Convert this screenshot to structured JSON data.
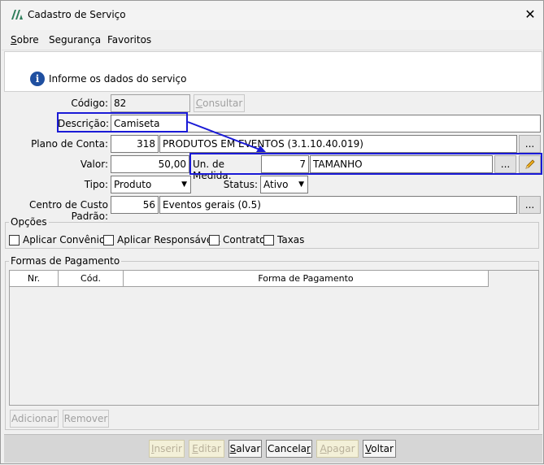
{
  "window": {
    "title": "Cadastro de Serviço",
    "close_glyph": "✕"
  },
  "menu": [
    {
      "label": "Sobre",
      "underline": "S"
    },
    {
      "label": "Segurança"
    },
    {
      "label": "Favoritos"
    }
  ],
  "header": {
    "icon": "info-icon",
    "text": "Informe os dados do serviço"
  },
  "form": {
    "codigo": {
      "label": "Código:",
      "value": "82",
      "button": "Consultar"
    },
    "descricao": {
      "label": "Descrição:",
      "value": "Camiseta"
    },
    "plano": {
      "label": "Plano de Conta:",
      "code": "318",
      "name": "PRODUTOS EM EVENTOS (3.1.10.40.019)",
      "button": "..."
    },
    "valor": {
      "label": "Valor:",
      "value": "50,00"
    },
    "unidade": {
      "label": "Un. de Medida:",
      "code": "7",
      "name": "TAMANHO",
      "button": "...",
      "edit_icon": "pencil-icon"
    },
    "tipo": {
      "label": "Tipo:",
      "value": "Produto"
    },
    "status": {
      "label": "Status:",
      "value": "Ativo"
    },
    "centro": {
      "label": "Centro de Custo Padrão:",
      "code": "56",
      "name": "Eventos gerais (0.5)",
      "button": "..."
    }
  },
  "opcoes": {
    "title": "Opções",
    "items": [
      {
        "label": "Aplicar Convênios",
        "checked": false
      },
      {
        "label": "Aplicar Responsáveis",
        "checked": false
      },
      {
        "label": "Contrato",
        "checked": false
      },
      {
        "label": "Taxas",
        "checked": false
      }
    ]
  },
  "pagamento": {
    "title": "Formas de Pagamento",
    "columns": [
      "Nr.",
      "Cód.",
      "Forma de Pagamento"
    ],
    "rows": [],
    "buttons": {
      "add": "Adicionar",
      "remove": "Remover"
    }
  },
  "footer": {
    "buttons": [
      {
        "label": "Inserir",
        "enabled": false
      },
      {
        "label": "Editar",
        "enabled": false
      },
      {
        "label": "Salvar",
        "enabled": true
      },
      {
        "label": "Cancelar",
        "enabled": true
      },
      {
        "label": "Apagar",
        "enabled": false
      },
      {
        "label": "Voltar",
        "enabled": true
      }
    ]
  },
  "colors": {
    "annotation": "#1a1ad6",
    "info_icon": "#1f4fa0",
    "footer_disabled": "#f3f0d8"
  }
}
